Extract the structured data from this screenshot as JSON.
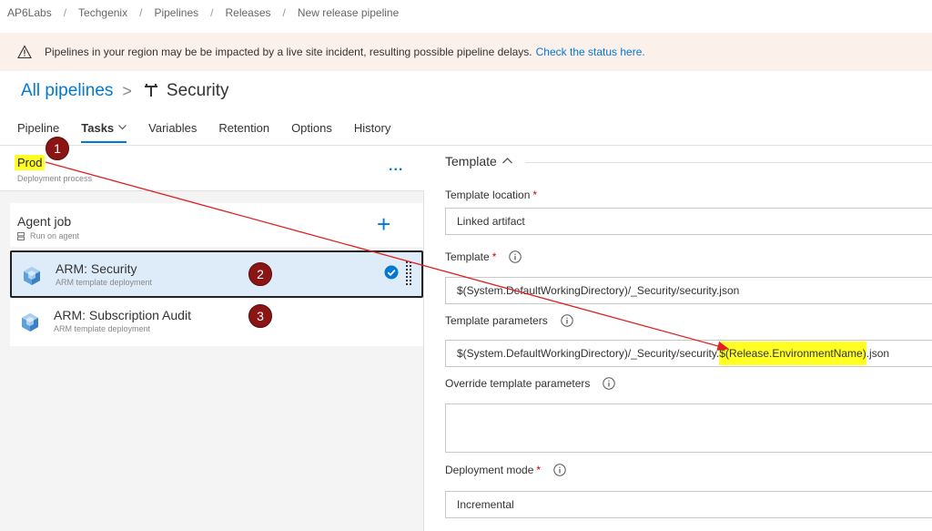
{
  "breadcrumb": [
    "AP6Labs",
    "Techgenix",
    "Pipelines",
    "Releases",
    "New release pipeline"
  ],
  "banner": {
    "icon": "warning-icon",
    "message": "Pipelines in your region may be be impacted by a live site incident, resulting possible pipeline delays.",
    "link": "Check the status here."
  },
  "header": {
    "all_pipelines": "All pipelines",
    "separator": ">",
    "title": "Security"
  },
  "tabs": [
    {
      "label": "Pipeline"
    },
    {
      "label": "Tasks",
      "active": true,
      "chevron": "⌵"
    },
    {
      "label": "Variables"
    },
    {
      "label": "Retention"
    },
    {
      "label": "Options"
    },
    {
      "label": "History"
    }
  ],
  "stage": {
    "name": "Prod",
    "subtitle": "Deployment process",
    "more": "..."
  },
  "agent_job": {
    "title": "Agent job",
    "subtitle": "Run on agent",
    "add": "+"
  },
  "tasks": [
    {
      "name": "ARM: Security",
      "subtitle": "ARM template deployment",
      "selected": true
    },
    {
      "name": "ARM: Subscription Audit",
      "subtitle": "ARM template deployment",
      "selected": false
    }
  ],
  "annotations": [
    "1",
    "2",
    "3"
  ],
  "template_section": {
    "heading": "Template",
    "location_label": "Template location",
    "location_value": "Linked artifact",
    "template_label": "Template",
    "template_value": "$(System.DefaultWorkingDirectory)/_Security/security.json",
    "params_label": "Template parameters",
    "params_value_prefix": "$(System.DefaultWorkingDirectory)/_Security/security.",
    "params_value_highlight": "$(Release.EnvironmentName)",
    "params_value_suffix": ".json",
    "override_label": "Override template parameters",
    "override_value": "",
    "mode_label": "Deployment mode",
    "mode_value": "Incremental",
    "required_mark": "*"
  },
  "colors": {
    "accent": "#0078d4",
    "highlight": "#ffff24",
    "badge": "#8b1414",
    "arrow": "#e02020",
    "banner_bg": "#fcf0eb"
  }
}
